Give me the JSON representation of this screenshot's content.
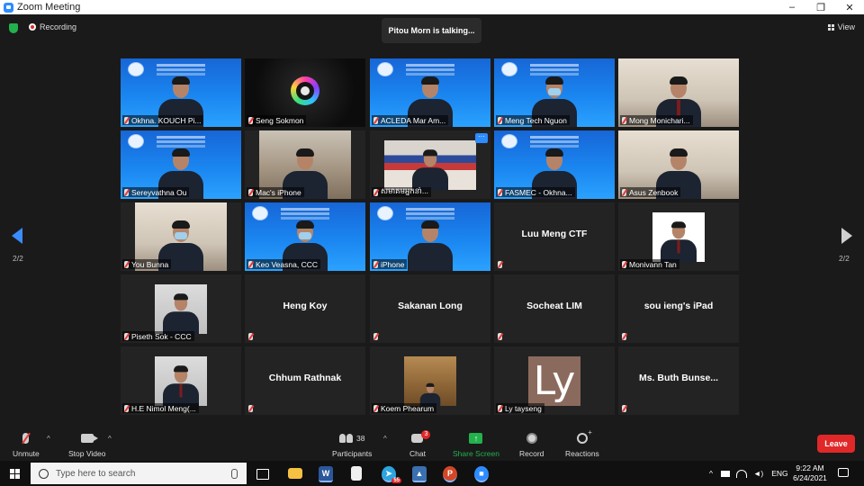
{
  "window": {
    "title": "Zoom Meeting",
    "minimize": "–",
    "maximize": "❐",
    "close": "✕"
  },
  "topbar": {
    "recording_label": "Recording",
    "talking_text": "Pitou Morn is talking...",
    "view_label": "View"
  },
  "pagination": {
    "left_page": "2/2",
    "right_page": "2/2"
  },
  "participants": [
    {
      "name": "Okhna. KOUCH Pi...",
      "video": "blue"
    },
    {
      "name": "Seng Sokmon",
      "video": "dark"
    },
    {
      "name": "ACLEDA Mar Am...",
      "video": "blue"
    },
    {
      "name": "Meng Tech Nguon",
      "video": "blue"
    },
    {
      "name": "Mong Monichari...",
      "video": "room2"
    },
    {
      "name": "Sereyvathna Ou",
      "video": "blue"
    },
    {
      "name": "Mac's iPhone",
      "video": "room"
    },
    {
      "name": "សមាគមអ្នកនាំ...",
      "video": "flag"
    },
    {
      "name": "FASMEC - Okhna...",
      "video": "blue"
    },
    {
      "name": "Asus Zenbook",
      "video": "room2"
    },
    {
      "name": "You Bunna",
      "video": "room2"
    },
    {
      "name": "Keo Veasna, CCC",
      "video": "blue"
    },
    {
      "name": "iPhone",
      "video": "blue"
    },
    {
      "name": "Luu Meng CTF",
      "video": "none"
    },
    {
      "name": "Monivann Tan",
      "video": "white"
    },
    {
      "name": "Piseth Sok - CCC",
      "video": "off"
    },
    {
      "name": "Heng Koy",
      "video": "none"
    },
    {
      "name": "Sakanan Long",
      "video": "none"
    },
    {
      "name": "Socheat LIM",
      "video": "none"
    },
    {
      "name": "sou ieng's iPad",
      "video": "none"
    },
    {
      "name": "H.E Nimol Meng(...",
      "video": "off"
    },
    {
      "name": "Chhum Rathnak",
      "video": "none"
    },
    {
      "name": "Koem Phearum",
      "video": "door"
    },
    {
      "name": "Ly tayseng",
      "video": "ly",
      "avatar_text": "Ly"
    },
    {
      "name": "Ms. Buth Bunse...",
      "video": "none"
    }
  ],
  "toolbar": {
    "unmute": "Unmute",
    "stop_video": "Stop Video",
    "participants": "Participants",
    "participant_count": "38",
    "chat": "Chat",
    "chat_badge": "3",
    "share_screen": "Share Screen",
    "record": "Record",
    "reactions": "Reactions",
    "leave": "Leave",
    "caret": "^"
  },
  "taskbar": {
    "search_placeholder": "Type here to search",
    "word": "W",
    "powerpoint": "P",
    "telegram_badge": "55",
    "language": "ENG",
    "time": "9:22 AM",
    "date": "6/24/2021"
  }
}
